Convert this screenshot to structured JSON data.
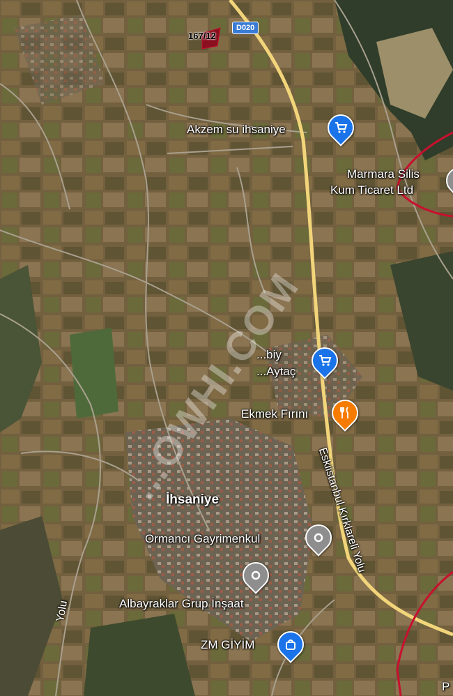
{
  "map": {
    "road_shield": "D020",
    "parcel_label": "167/12",
    "watermark": "...OWHI.COM",
    "place_labels": {
      "akzem": "Akzem su ihsaniye",
      "marmara1": "Marmara Silis",
      "marmara2": "Kum Ticaret Ltd",
      "aytac1": "...biy",
      "aytac2": "...Aytaç",
      "ekmek": "Ekmek Fırını",
      "ihsaniye": "İhsaniye",
      "ormanci": "Ormancı Gayrimenkul",
      "albayraklar": "Albayraklar Grup İnşaat",
      "zm": "ZM GİYİM",
      "road": "Eskiistanbul Kırklareli Yolu",
      "yolu": "Yolu",
      "edge_p": "P"
    },
    "colors": {
      "shopping_pin": "#1a73e8",
      "food_pin": "#f57c00",
      "generic_pin": "#8e8e8e",
      "boundary": "#c8102e",
      "highway": "#f2d57a"
    },
    "icons": {
      "shopping": "shopping-cart-icon",
      "food": "fork-knife-icon",
      "generic": "location-dot-icon",
      "clothing": "shopping-bag-icon"
    }
  }
}
